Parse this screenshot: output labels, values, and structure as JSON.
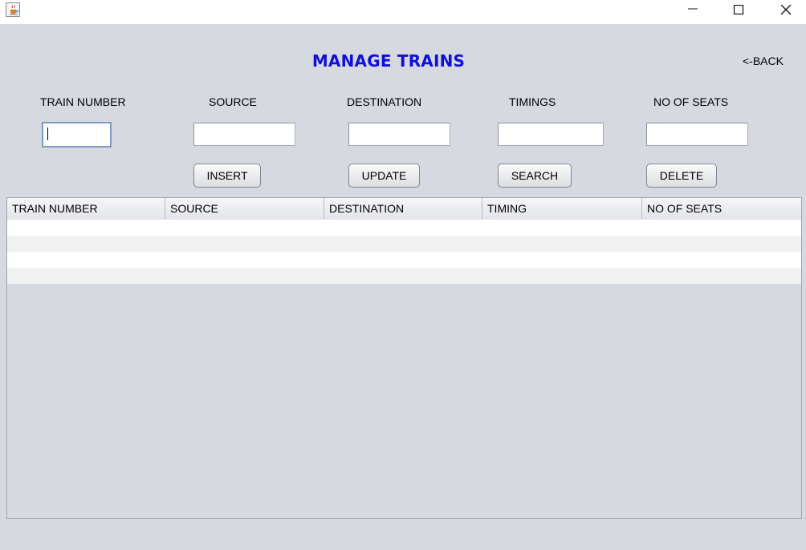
{
  "window": {
    "app_icon": "java-coffee-cup-icon",
    "controls": [
      "minimize-icon",
      "maximize-icon",
      "close-icon"
    ]
  },
  "title": "MANAGE TRAINS",
  "back_link": "<-BACK",
  "form": {
    "labels": {
      "train_number": "TRAIN NUMBER",
      "source": "SOURCE",
      "destination": "DESTINATION",
      "timings": "TIMINGS",
      "seats": "NO OF SEATS"
    },
    "values": {
      "train_number": "",
      "source": "",
      "destination": "",
      "timings": "",
      "seats": ""
    },
    "buttons": {
      "insert": "INSERT",
      "update": "UPDATE",
      "search": "SEARCH",
      "delete": "DELETE"
    }
  },
  "table": {
    "columns": [
      "TRAIN NUMBER",
      "SOURCE",
      "DESTINATION",
      "TIMING",
      "NO OF SEATS"
    ],
    "rows": [
      [
        "",
        "",
        "",
        "",
        ""
      ],
      [
        "",
        "",
        "",
        "",
        ""
      ],
      [
        "",
        "",
        "",
        "",
        ""
      ],
      [
        "",
        "",
        "",
        "",
        ""
      ]
    ]
  },
  "colors": {
    "title": "#1010d8",
    "background": "#d6d9e0",
    "focus_border": "#7a9cc6"
  }
}
